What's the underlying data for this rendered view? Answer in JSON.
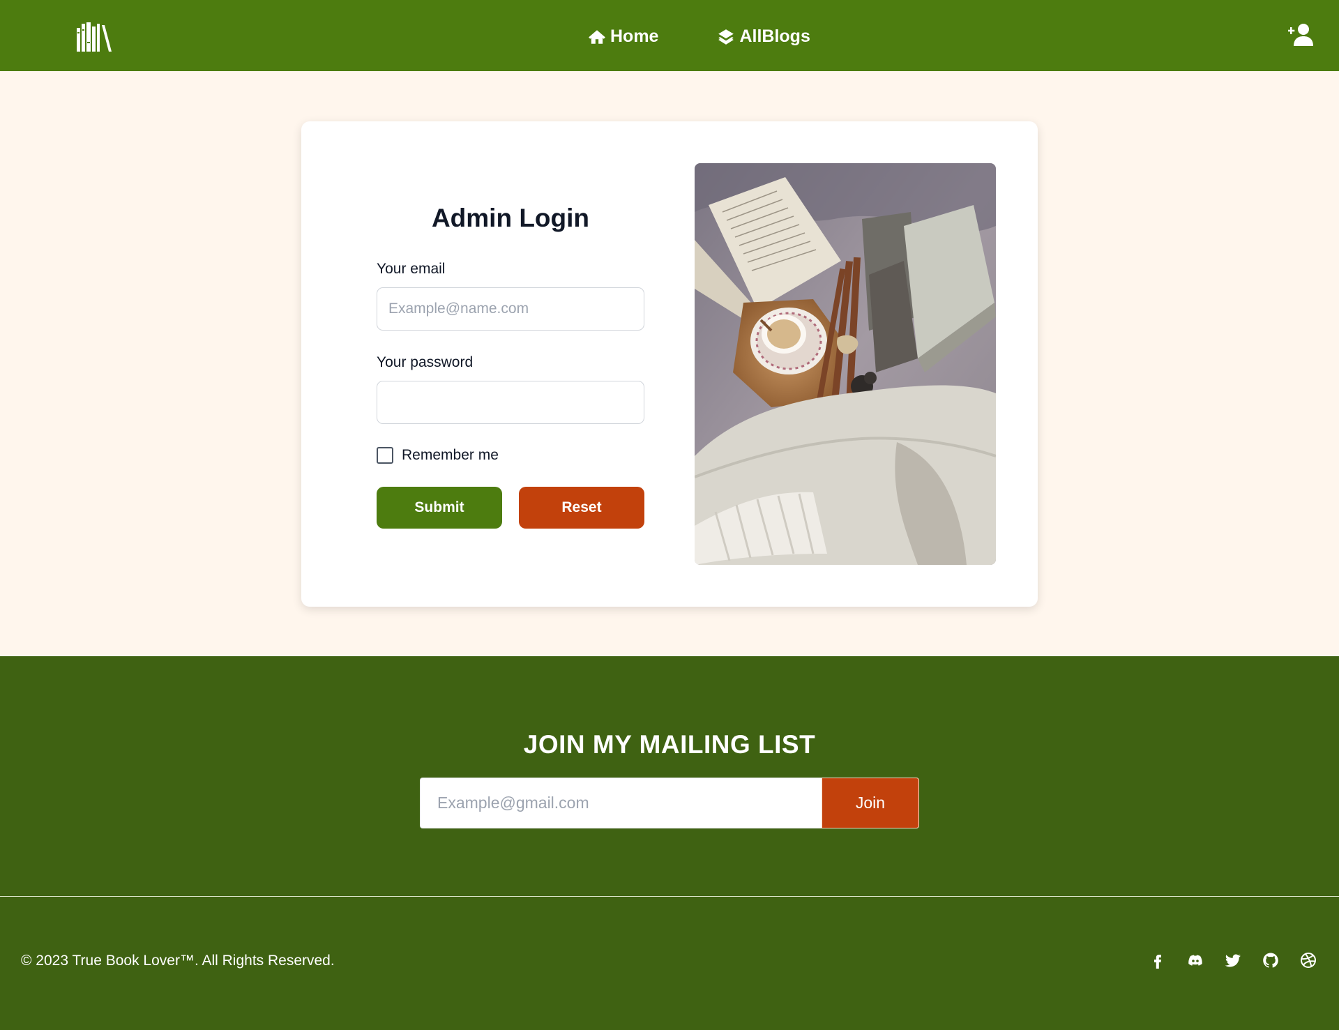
{
  "nav": {
    "logo_icon": "books-logo-icon",
    "links": [
      {
        "label": "Home",
        "icon": "home-icon"
      },
      {
        "label": "AllBlogs",
        "icon": "layers-icon"
      }
    ],
    "user_icon": "user-add-icon"
  },
  "login": {
    "title": "Admin Login",
    "email_label": "Your email",
    "email_placeholder": "Example@name.com",
    "email_value": "",
    "password_label": "Your password",
    "password_value": "",
    "remember_label": "Remember me",
    "remember_checked": false,
    "submit_label": "Submit",
    "reset_label": "Reset"
  },
  "mailing": {
    "title": "JOIN MY MAILING LIST",
    "placeholder": "Example@gmail.com",
    "value": "",
    "join_label": "Join"
  },
  "footer": {
    "copyright": "© 2023 True Book Lover™. All Rights Reserved.",
    "social_icons": [
      "facebook-icon",
      "discord-icon",
      "twitter-icon",
      "github-icon",
      "dribbble-icon"
    ]
  },
  "colors": {
    "nav_bg": "#4d7c0f",
    "page_bg": "#fff6ed",
    "footer_bg": "#3f6212",
    "submit": "#4d7c0f",
    "reset": "#c2410c",
    "join": "#c2410c"
  }
}
